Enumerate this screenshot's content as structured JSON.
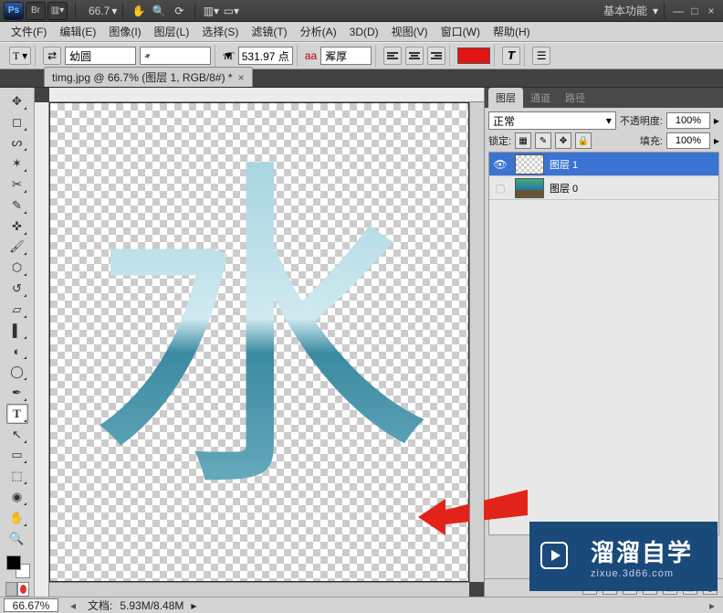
{
  "launch": {
    "ps": "Ps",
    "br": "Br",
    "mb": "▦",
    "zoom": "66.7",
    "workspace": "基本功能"
  },
  "menu": {
    "file": "文件(F)",
    "edit": "编辑(E)",
    "image": "图像(I)",
    "layer": "图层(L)",
    "select": "选择(S)",
    "filter": "滤镜(T)",
    "analysis": "分析(A)",
    "threeD": "3D(D)",
    "view": "视图(V)",
    "window": "窗口(W)",
    "help": "帮助(H)"
  },
  "options": {
    "toggle_icon": "⇄",
    "font_family": "幼圆",
    "font_style": "-",
    "size_value": "531.97 点",
    "aa_label": "aa",
    "aa_value": "浑厚",
    "T_icon": "T"
  },
  "doc_tab": {
    "title": "timg.jpg @ 66.7% (图层 1, RGB/8#) *",
    "close": "×"
  },
  "panels": {
    "tabs": {
      "layers": "图层",
      "channels": "通道",
      "paths": "路径"
    },
    "blend_mode": "正常",
    "opacity_label": "不透明度:",
    "opacity_value": "100%",
    "lock_label": "锁定:",
    "fill_label": "填充:",
    "fill_value": "100%",
    "layer1": "图层 1",
    "layer0": "图层 0"
  },
  "status": {
    "zoom": "66.67%",
    "doc_label": "文档:",
    "doc_value": "5.93M/8.48M"
  },
  "watermark": {
    "big": "溜溜自学",
    "small": "zixue.3d66.com"
  },
  "canvas_glyph": "水"
}
